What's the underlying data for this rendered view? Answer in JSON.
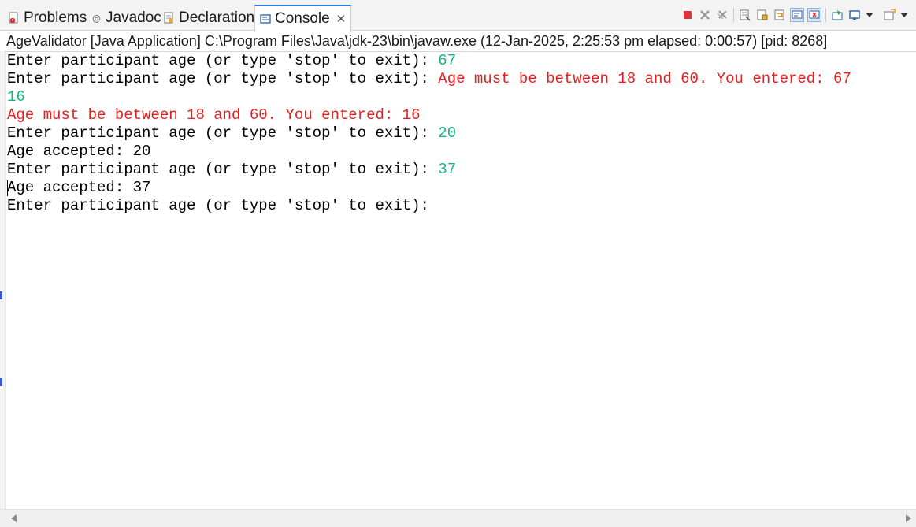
{
  "tabs": [
    {
      "label": "Problems",
      "icon": "problems-icon"
    },
    {
      "label": "Javadoc",
      "icon": "javadoc-icon"
    },
    {
      "label": "Declaration",
      "icon": "declaration-icon"
    },
    {
      "label": "Console",
      "icon": "console-icon",
      "active": true
    }
  ],
  "tab_close_glyph": "✕",
  "toolbar_icons": [
    "terminate-icon",
    "remove-launch-icon",
    "remove-all-terminated-icon",
    "clear-console-icon",
    "scroll-lock-icon",
    "word-wrap-icon",
    "show-stdout-icon",
    "show-stderr-icon",
    "pin-console-icon",
    "display-console-icon",
    "display-menu-icon",
    "open-console-icon",
    "open-menu-icon"
  ],
  "process_description": "AgeValidator [Java Application] C:\\Program Files\\Java\\jdk-23\\bin\\javaw.exe  (12-Jan-2025, 2:25:53 pm elapsed: 0:00:57) [pid: 8268]",
  "console_lines": [
    {
      "prompt": "Enter participant age (or type 'stop' to exit): ",
      "input": "67",
      "error": ""
    },
    {
      "prompt": "Enter participant age (or type 'stop' to exit): ",
      "input": "",
      "error": "Age must be between 18 and 60. You entered: 67"
    },
    {
      "prompt": "",
      "input": "16",
      "error": ""
    },
    {
      "prompt": "",
      "input": "",
      "error": "Age must be between 18 and 60. You entered: 16"
    },
    {
      "prompt": "Enter participant age (or type 'stop' to exit): ",
      "input": "20",
      "error": ""
    },
    {
      "prompt": "Age accepted: 20",
      "input": "",
      "error": ""
    },
    {
      "prompt": "Enter participant age (or type 'stop' to exit): ",
      "input": "37",
      "error": ""
    },
    {
      "prompt": "Age accepted: 37",
      "input": "",
      "error": ""
    },
    {
      "prompt": "Enter participant age (or type 'stop' to exit): ",
      "input": "",
      "error": ""
    }
  ],
  "colors": {
    "stdin": "#12b67f",
    "stderr": "#e81e1e",
    "stdout": "#000000",
    "active_tab_accent": "#2f7ad6"
  }
}
